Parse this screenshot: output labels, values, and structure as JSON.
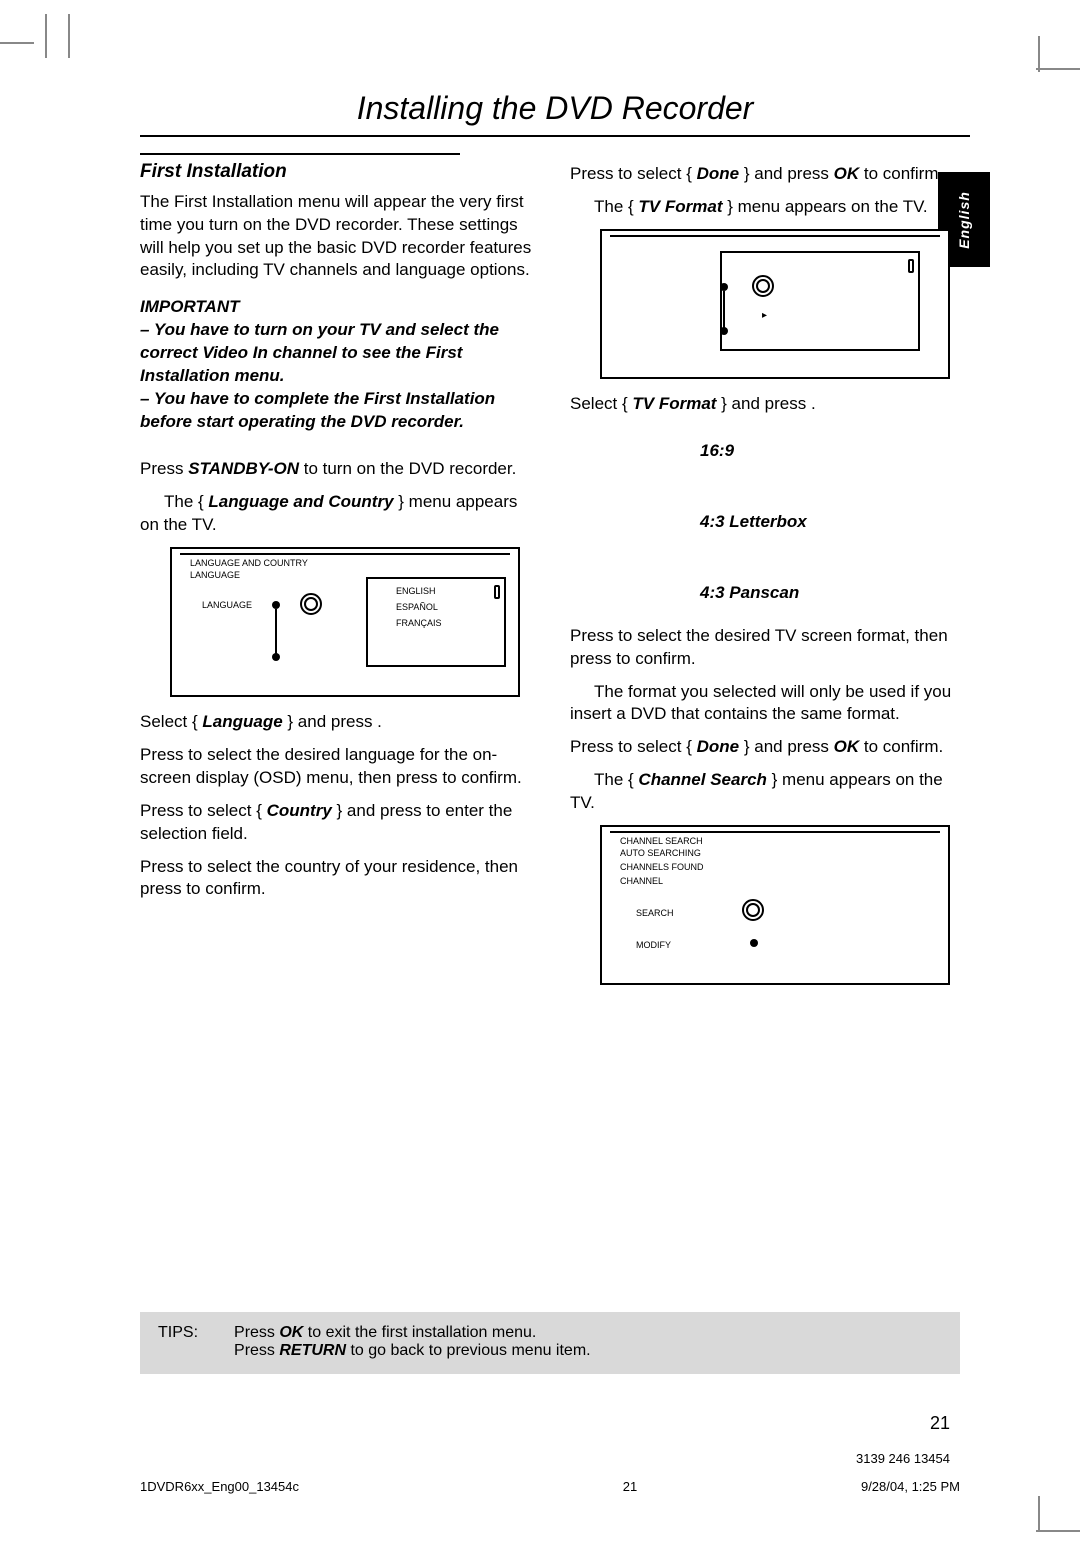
{
  "title": "Installing the DVD Recorder",
  "lang_tab": "English",
  "section": "First Installation",
  "intro": "The First Installation menu will appear the very first time you turn on the DVD recorder. These settings will help you set up the basic DVD recorder features easily, including TV channels and language options.",
  "important": {
    "heading": "IMPORTANT",
    "line1": "– You have to turn on your TV and select the correct Video In channel to see the First Installation menu.",
    "line2": "– You have to complete the First Installation before start operating the DVD recorder."
  },
  "left": {
    "s1_a": "Press ",
    "s1_b": "STANDBY-ON",
    "s1_c": " to turn on the DVD recorder.",
    "s1_res_a": "The { ",
    "s1_res_b": "Language and Country",
    "s1_res_c": " } menu appears on the TV.",
    "s2_a": "Select { ",
    "s2_b": "Language",
    "s2_c": " } and press  .",
    "s3": "Press  to select the desired language for the on-screen display (OSD) menu, then press  to confirm.",
    "s4_a": "Press  to select { ",
    "s4_b": "Country",
    "s4_c": " } and press  to enter the selection field.",
    "s5": "Press  to select the country of your residence, then press  to confirm."
  },
  "right": {
    "r1_a": "Press  to select { ",
    "r1_b": "Done",
    "r1_c": " } and press ",
    "r1_d": "OK",
    "r1_e": " to confirm.",
    "r1_res_a": "The { ",
    "r1_res_b": "TV Format",
    "r1_res_c": " } menu appears on the TV.",
    "r2_a": "Select { ",
    "r2_b": "TV Format",
    "r2_c": " } and press  .",
    "fmt_169": "16:9",
    "fmt_43l": "4:3 Letterbox",
    "fmt_43p": "4:3 Panscan",
    "r3": "Press  to select the desired TV screen format, then press  to confirm.",
    "r3_res": "The format you selected will only be used if you insert a DVD that contains the same format.",
    "r4_a": "Press  to select { ",
    "r4_b": "Done",
    "r4_c": " } and press ",
    "r4_d": "OK",
    "r4_e": " to confirm.",
    "r4_res_a": "The { ",
    "r4_res_b": "Channel Search",
    "r4_res_c": " } menu appears on the TV."
  },
  "tips": {
    "label": "TIPS:",
    "l1_a": "Press ",
    "l1_b": "OK",
    "l1_c": " to exit the first installation menu.",
    "l2_a": "Press ",
    "l2_b": "RETURN",
    "l2_c": " to go back to previous menu item."
  },
  "page_number": "21",
  "footer": {
    "file": "1DVDR6xx_Eng00_13454c",
    "pg": "21",
    "date": "9/28/04, 1:25 PM",
    "partno": "3139 246 13454"
  },
  "diagram1": {
    "title1": "LANGUAGE AND COUNTRY",
    "title2": "LANGUAGE",
    "row": "LANGUAGE",
    "opt1": "ENGLISH",
    "opt2": "ESPAÑOL",
    "opt3": "FRANÇAIS"
  },
  "diagram3": {
    "title1": "CHANNEL SEARCH",
    "title2": "AUTO SEARCHING",
    "row1": "CHANNELS FOUND",
    "row2": "CHANNEL",
    "row3": "SEARCH",
    "row4": "MODIFY"
  }
}
